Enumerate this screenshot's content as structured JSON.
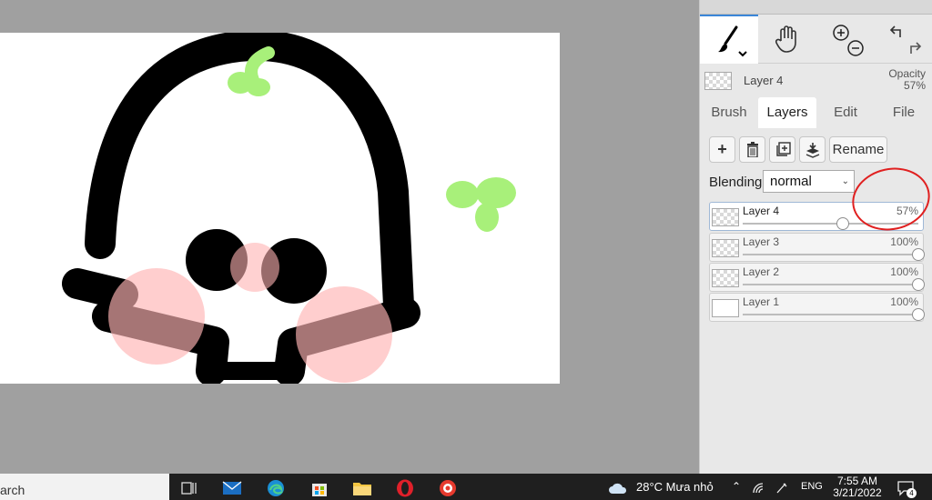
{
  "panel": {
    "current_layer": {
      "name": "Layer 4",
      "opacity_label": "Opacity",
      "opacity_value": "57%"
    },
    "tabs": [
      {
        "label": "Brush"
      },
      {
        "label": "Layers"
      },
      {
        "label": "Edit"
      },
      {
        "label": "File"
      }
    ],
    "toolbar": {
      "rename_label": "Rename"
    },
    "blending": {
      "label": "Blending",
      "value": "normal"
    },
    "layers": [
      {
        "name": "Layer 4",
        "opacity": "57%",
        "level": 0.57,
        "active": true
      },
      {
        "name": "Layer 3",
        "opacity": "100%",
        "level": 1.0,
        "active": false
      },
      {
        "name": "Layer 2",
        "opacity": "100%",
        "level": 1.0,
        "active": false
      },
      {
        "name": "Layer 1",
        "opacity": "100%",
        "level": 1.0,
        "active": false
      }
    ]
  },
  "taskbar": {
    "search_text": "arch",
    "weather": "28°C  Mưa nhỏ",
    "language": "ENG",
    "time": "7:55 AM",
    "date": "3/21/2022",
    "notification_count": "4"
  },
  "colors": {
    "accent": "#3b86d8",
    "annotation": "#e02020",
    "blush": "#ffb3b3",
    "leaf": "#a8f07a"
  }
}
